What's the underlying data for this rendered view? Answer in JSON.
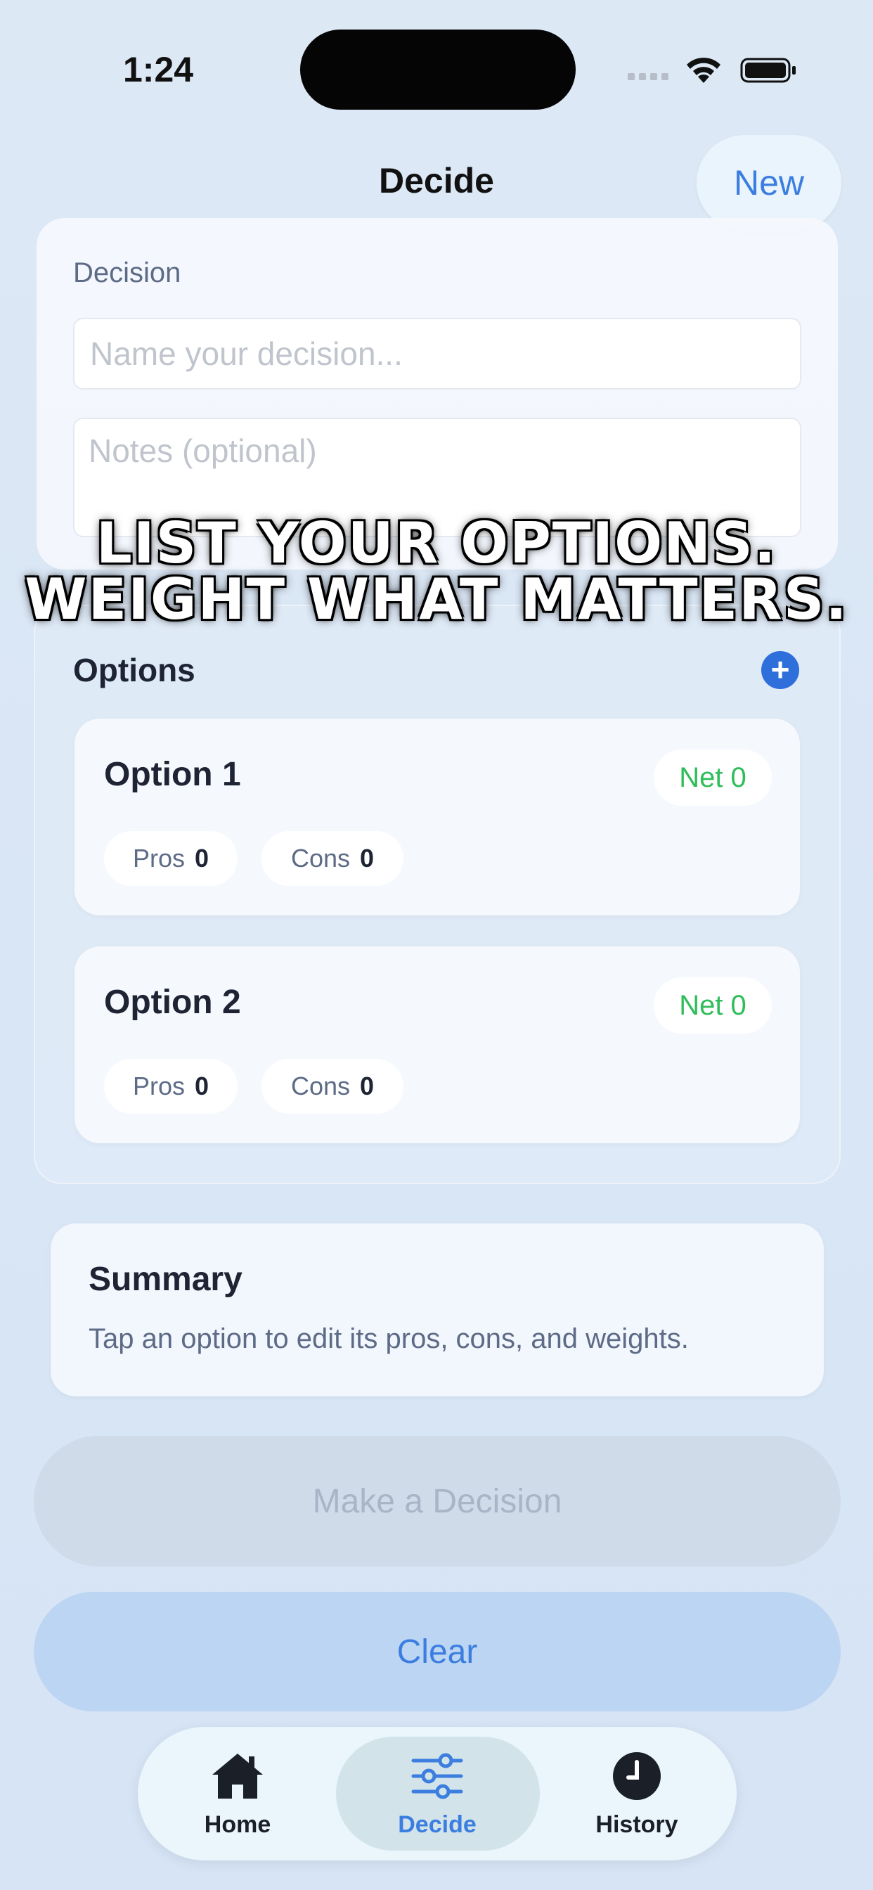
{
  "status_bar": {
    "time": "1:24"
  },
  "nav": {
    "title": "Decide",
    "new_label": "New"
  },
  "decision": {
    "label": "Decision",
    "name_placeholder": "Name your decision...",
    "notes_placeholder": "Notes (optional)"
  },
  "overlay": {
    "line1": "LIST YOUR OPTIONS.",
    "line2": "WEIGHT WHAT MATTERS."
  },
  "options": {
    "title": "Options",
    "items": [
      {
        "title": "Option 1",
        "net_label": "Net 0",
        "pros_label": "Pros",
        "pros_count": "0",
        "cons_label": "Cons",
        "cons_count": "0"
      },
      {
        "title": "Option 2",
        "net_label": "Net 0",
        "pros_label": "Pros",
        "pros_count": "0",
        "cons_label": "Cons",
        "cons_count": "0"
      }
    ]
  },
  "summary": {
    "title": "Summary",
    "text": "Tap an option to edit its pros, cons, and weights."
  },
  "buttons": {
    "make_decision": "Make a Decision",
    "clear": "Clear"
  },
  "tabs": [
    {
      "label": "Home",
      "icon": "house-icon"
    },
    {
      "label": "Decide",
      "icon": "sliders-icon",
      "active": true
    },
    {
      "label": "History",
      "icon": "clock-icon"
    }
  ],
  "colors": {
    "accent": "#3b7ee0",
    "positive": "#2ebd59",
    "muted": "#5d6b86"
  }
}
